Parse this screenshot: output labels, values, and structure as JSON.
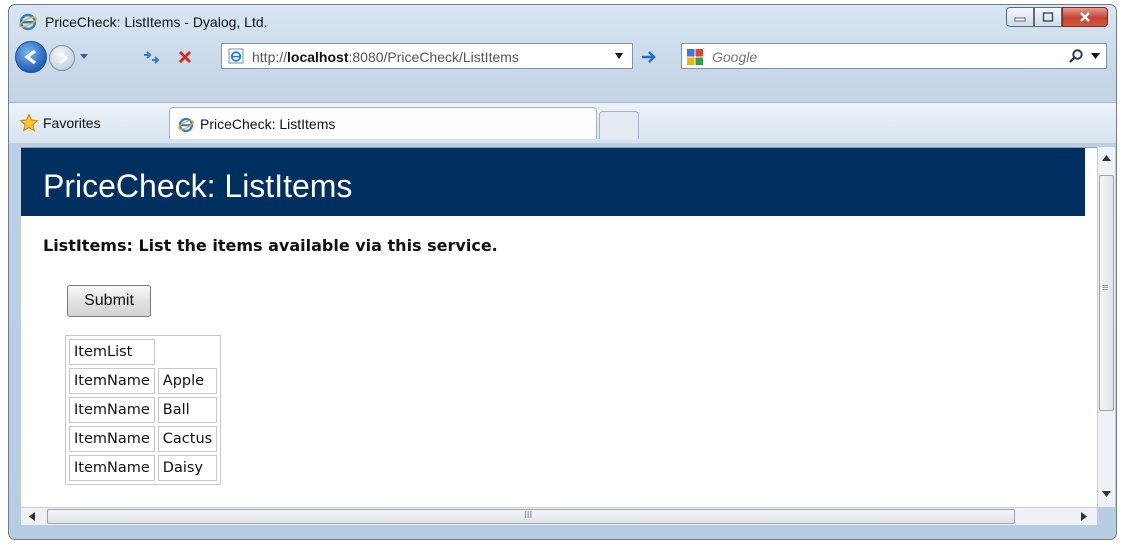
{
  "window": {
    "title": "PriceCheck: ListItems - Dyalog, Ltd."
  },
  "address_bar": {
    "url_prefix": "http://",
    "url_host": "localhost",
    "url_rest": ":8080/PriceCheck/ListItems"
  },
  "search_box": {
    "placeholder": "Google"
  },
  "tabs": {
    "favorites_label": "Favorites",
    "active_tab_label": "PriceCheck: ListItems"
  },
  "page": {
    "banner_title": "PriceCheck: ListItems",
    "description": "ListItems: List the items available via this service.",
    "submit_label": "Submit",
    "table": {
      "header": "ItemList",
      "rows": [
        {
          "key": "ItemName",
          "value": "Apple"
        },
        {
          "key": "ItemName",
          "value": "Ball"
        },
        {
          "key": "ItemName",
          "value": "Cactus"
        },
        {
          "key": "ItemName",
          "value": "Daisy"
        }
      ]
    }
  },
  "colors": {
    "banner": "#00305f",
    "chrome": "#c9d9ea",
    "close_button": "#c4422f"
  },
  "scrollbars": {
    "horizontal_grip": "III",
    "vertical_grip": "≡"
  }
}
